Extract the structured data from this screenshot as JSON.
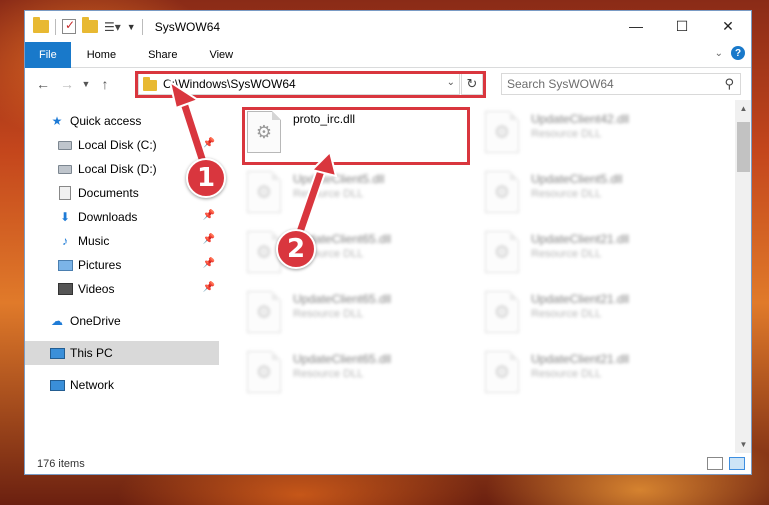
{
  "window": {
    "title": "SysWOW64",
    "controls": {
      "minimize": "—",
      "maximize": "☐",
      "close": "✕"
    }
  },
  "ribbon": {
    "tabs": [
      "File",
      "Home",
      "Share",
      "View"
    ],
    "expand_icon": "chevron-down-icon",
    "help_label": "?"
  },
  "nav": {
    "address": "C:\\Windows\\SysWOW64",
    "search_placeholder": "Search SysWOW64"
  },
  "sidebar": {
    "items": [
      {
        "label": "Quick access",
        "icon": "star-icon"
      },
      {
        "label": "Local Disk (C:)",
        "icon": "disk-icon",
        "pinned": true
      },
      {
        "label": "Local Disk (D:)",
        "icon": "disk-icon"
      },
      {
        "label": "Documents",
        "icon": "documents-icon"
      },
      {
        "label": "Downloads",
        "icon": "downloads-icon",
        "pinned": true
      },
      {
        "label": "Music",
        "icon": "music-icon",
        "pinned": true
      },
      {
        "label": "Pictures",
        "icon": "pictures-icon",
        "pinned": true
      },
      {
        "label": "Videos",
        "icon": "videos-icon",
        "pinned": true
      },
      {
        "label": "OneDrive",
        "icon": "cloud-icon"
      },
      {
        "label": "This PC",
        "icon": "pc-icon",
        "selected": true
      },
      {
        "label": "Network",
        "icon": "network-icon"
      }
    ]
  },
  "files": {
    "focused": {
      "name": "proto_irc.dll"
    },
    "left_column": [
      {
        "name": "UpdateClient5.dll",
        "type": "Resource DLL"
      },
      {
        "name": "UpdateClient65.dll",
        "type": "Resource DLL"
      },
      {
        "name": "UpdateClient65.dll",
        "type": "Resource DLL"
      },
      {
        "name": "UpdateClient65.dll",
        "type": "Resource DLL"
      }
    ],
    "right_column": [
      {
        "name": "UpdateClient42.dll",
        "type": "Resource DLL"
      },
      {
        "name": "UpdateClient5.dll",
        "type": "Resource DLL"
      },
      {
        "name": "UpdateClient21.dll",
        "type": "Resource DLL"
      },
      {
        "name": "UpdateClient21.dll",
        "type": "Resource DLL"
      },
      {
        "name": "UpdateClient21.dll",
        "type": "Resource DLL"
      }
    ]
  },
  "status": {
    "item_count": "176 items"
  },
  "annotations": {
    "step1": "1",
    "step2": "2",
    "color": "#d9363e"
  },
  "colors": {
    "accent": "#1979ca",
    "highlight": "#d9363e",
    "selected": "#d9d9d9"
  }
}
